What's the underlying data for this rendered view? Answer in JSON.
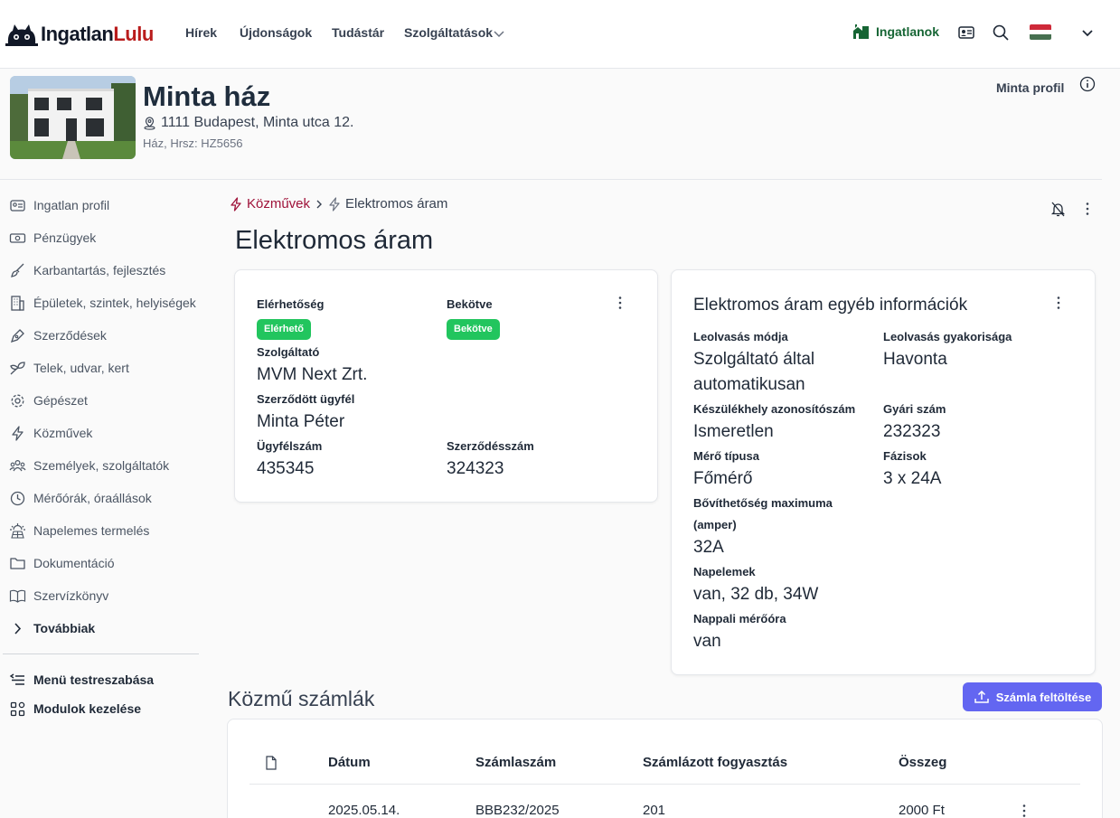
{
  "brand": {
    "name_part1": "Ingatlan",
    "name_part2": "Lulu",
    "accent": "#b91c1c"
  },
  "nav": {
    "links": [
      "Hírek",
      "Újdonságok",
      "Tudástár",
      "Szolgáltatások"
    ],
    "properties_label": "Ingatlanok",
    "icons": [
      "house-icon",
      "id-card-icon",
      "search-icon",
      "hungarian-flag",
      "chevron-down-icon"
    ]
  },
  "property": {
    "title": "Minta ház",
    "address": "1111 Budapest, Minta utca 12.",
    "subtitle": "Ház, Hrsz: HZ5656",
    "profile_type": "Minta profil"
  },
  "sidebar": {
    "items": [
      {
        "label": "Ingatlan profil",
        "icon": "id-card-icon"
      },
      {
        "label": "Pénzügyek",
        "icon": "banknote-icon"
      },
      {
        "label": "Karbantartás, fejlesztés",
        "icon": "brush-icon"
      },
      {
        "label": "Épületek, szintek, helyiségek",
        "icon": "building-icon"
      },
      {
        "label": "Szerződések",
        "icon": "pen-icon"
      },
      {
        "label": "Telek, udvar, kert",
        "icon": "leaf-icon"
      },
      {
        "label": "Gépészet",
        "icon": "gear-icon"
      },
      {
        "label": "Közművek",
        "icon": "bolt-icon"
      },
      {
        "label": "Személyek, szolgáltatók",
        "icon": "people-icon"
      },
      {
        "label": "Mérőórák, óraállások",
        "icon": "clock-icon"
      },
      {
        "label": "Napelemes termelés",
        "icon": "solar-icon"
      },
      {
        "label": "Dokumentáció",
        "icon": "folder-icon"
      },
      {
        "label": "Szervízkönyv",
        "icon": "book-icon"
      },
      {
        "label": "Továbbiak",
        "icon": "chevron-right-icon"
      }
    ],
    "bottom": [
      {
        "label": "Menü testreszabása",
        "icon": "menu-edit-icon"
      },
      {
        "label": "Modulok kezelése",
        "icon": "modules-icon"
      }
    ]
  },
  "breadcrumb": {
    "parent": "Közművek",
    "current": "Elektromos áram"
  },
  "page_title": "Elektromos áram",
  "main_card": {
    "availability_label": "Elérhetőség",
    "availability_badge": "Elérhető",
    "connected_label": "Bekötve",
    "connected_badge": "Bekötve",
    "provider_label": "Szolgáltató",
    "provider_value": "MVM Next Zrt.",
    "customer_label": "Szerződött ügyfél",
    "customer_value": "Minta Péter",
    "customer_no_label": "Ügyfélszám",
    "customer_no_value": "435345",
    "contract_no_label": "Szerződésszám",
    "contract_no_value": "324323",
    "badge_color": "#22c55e"
  },
  "info_card": {
    "title": "Elektromos áram egyéb információk",
    "reading_mode_label": "Leolvasás módja",
    "reading_mode_value_line1": "Szolgáltató által",
    "reading_mode_value_line2": "automatikusan",
    "reading_freq_label": "Leolvasás gyakorisága",
    "reading_freq_value": "Havonta",
    "device_id_label": "Készülékhely azonosítószám",
    "device_id_value": "Ismeretlen",
    "serial_label": "Gyári szám",
    "serial_value": "232323",
    "meter_type_label": "Mérő típusa",
    "meter_type_value": "Főmérő",
    "phases_label": "Fázisok",
    "phases_value": "3 x 24A",
    "max_ext_label_line1": "Bővíthetőség maximuma",
    "max_ext_label_line2": "(amper)",
    "max_ext_value": "32A",
    "solar_label": "Napelemek",
    "solar_value": "van, 32 db, 34W",
    "day_meter_label": "Nappali mérőóra",
    "day_meter_value": "van"
  },
  "bills": {
    "title": "Közmű számlák",
    "upload_label": "Számla feltöltése",
    "upload_color": "#6366f1",
    "columns": [
      "Dátum",
      "Számlaszám",
      "Számlázott fogyasztás",
      "Összeg"
    ],
    "rows": [
      {
        "date": "2025.05.14.",
        "invoice_no": "BBB232/2025",
        "consumption": "201",
        "amount": "2000 Ft"
      }
    ]
  }
}
